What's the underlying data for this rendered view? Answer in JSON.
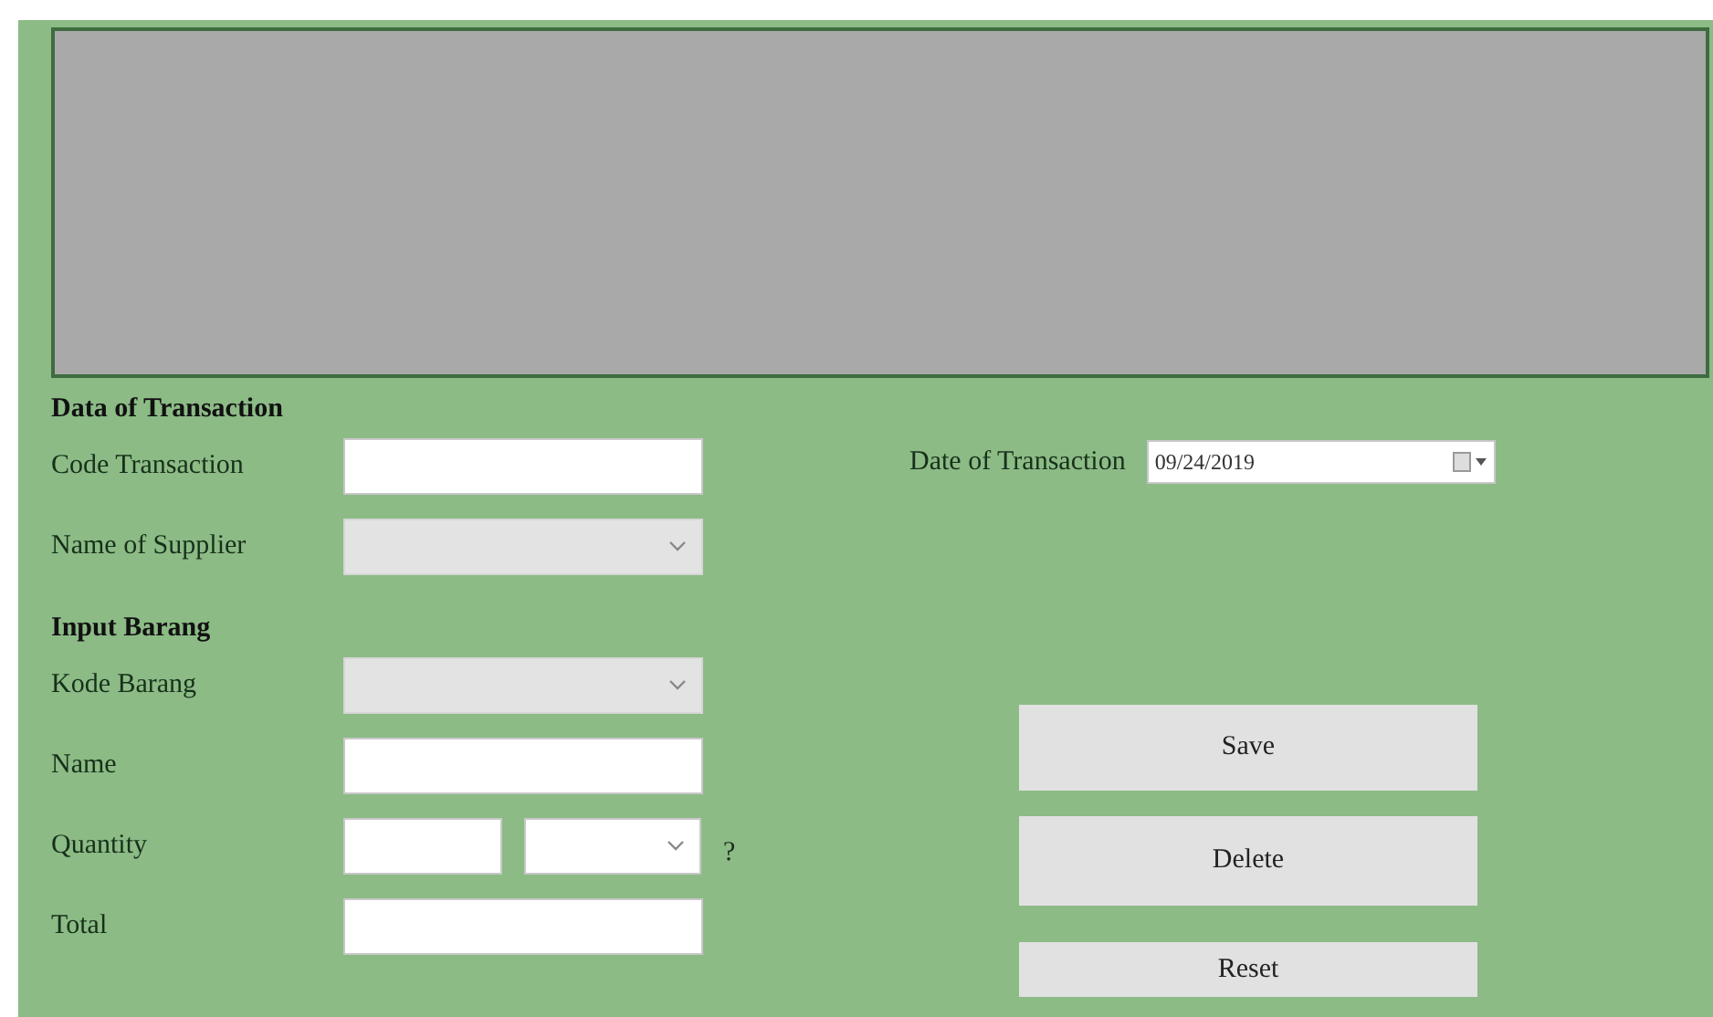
{
  "sections": [
    {
      "title": "Data of Transaction",
      "fields": [
        {
          "kind": "text",
          "label": "Code Transaction"
        },
        {
          "kind": "select",
          "label": "Name of Supplier",
          "disabled": true
        }
      ]
    },
    {
      "title": "Input Barang",
      "fields": [
        {
          "kind": "select",
          "label": "Kode Barang",
          "disabled": true
        },
        {
          "kind": "text",
          "label": "Name"
        },
        {
          "kind": "quantity",
          "label": "Quantity",
          "unit_disabled": false,
          "hint": "?"
        },
        {
          "kind": "text",
          "label": "Total"
        }
      ]
    }
  ],
  "date_field": {
    "label": "Date of Transaction",
    "value": "09/24/2019"
  },
  "buttons": [
    "Save",
    "Delete",
    "Reset"
  ]
}
